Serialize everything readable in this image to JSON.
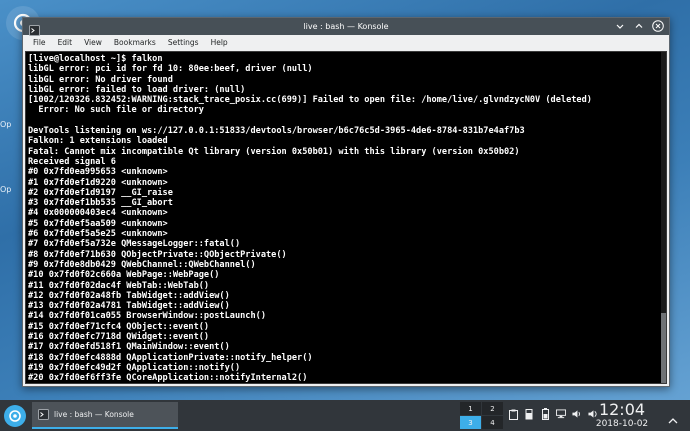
{
  "desktop": {
    "side_labels": [
      "Op",
      "Op"
    ]
  },
  "window": {
    "title": "live : bash — Konsole",
    "menu": [
      "File",
      "Edit",
      "View",
      "Bookmarks",
      "Settings",
      "Help"
    ]
  },
  "terminal": {
    "lines": [
      "[live@localhost ~]$ falkon",
      "libGL error: pci id for fd 10: 80ee:beef, driver (null)",
      "libGL error: No driver found",
      "libGL error: failed to load driver: (null)",
      "[1002/120326.832452:WARNING:stack_trace_posix.cc(699)] Failed to open file: /home/live/.glvndzycN0V (deleted)",
      "  Error: No such file or directory",
      "",
      "DevTools listening on ws://127.0.0.1:51833/devtools/browser/b6c76c5d-3965-4de6-8784-831b7e4af7b3",
      "Falkon: 1 extensions loaded",
      "Fatal: Cannot mix incompatible Qt library (version 0x50b01) with this library (version 0x50b02)",
      "Received signal 6",
      "#0 0x7fd0ea995653 <unknown>",
      "#1 0x7fd0ef1d9220 <unknown>",
      "#2 0x7fd0ef1d9197 __GI_raise",
      "#3 0x7fd0ef1bb535 __GI_abort",
      "#4 0x000000403ec4 <unknown>",
      "#5 0x7fd0ef5aa509 <unknown>",
      "#6 0x7fd0ef5a5e25 <unknown>",
      "#7 0x7fd0ef5a732e QMessageLogger::fatal()",
      "#8 0x7fd0ef71b630 QObjectPrivate::QObjectPrivate()",
      "#9 0x7fd0e8db0429 QWebChannel::QWebChannel()",
      "#10 0x7fd0f02c660a WebPage::WebPage()",
      "#11 0x7fd0f02dac4f WebTab::WebTab()",
      "#12 0x7fd0f02a48fb TabWidget::addView()",
      "#13 0x7fd0f02a4781 TabWidget::addView()",
      "#14 0x7fd0f01ca055 BrowserWindow::postLaunch()",
      "#15 0x7fd0ef71cfc4 QObject::event()",
      "#16 0x7fd0efc7718d QWidget::event()",
      "#17 0x7fd0efd518f1 QMainWindow::event()",
      "#18 0x7fd0efc4888d QApplicationPrivate::notify_helper()",
      "#19 0x7fd0efc49d2f QApplication::notify()",
      "#20 0x7fd0ef6ff3fe QCoreApplication::notifyInternal2()"
    ]
  },
  "taskbar": {
    "task_label": "live : bash — Konsole",
    "pager": [
      "1",
      "2",
      "3",
      "4"
    ],
    "active_desktop": "3",
    "clock_time": "12:04",
    "clock_date": "2018-10-02"
  },
  "colors": {
    "accent": "#3daee9",
    "titlebar": "#475057",
    "terminal_bg": "#000000",
    "panel": "#31363b"
  },
  "icons": {
    "launcher": "kde-launcher-icon",
    "konsole": "konsole-icon",
    "tray": [
      "clipboard-icon",
      "usb-icon",
      "battery-icon",
      "network-icon",
      "volume-icon",
      "speaker-icon"
    ]
  }
}
